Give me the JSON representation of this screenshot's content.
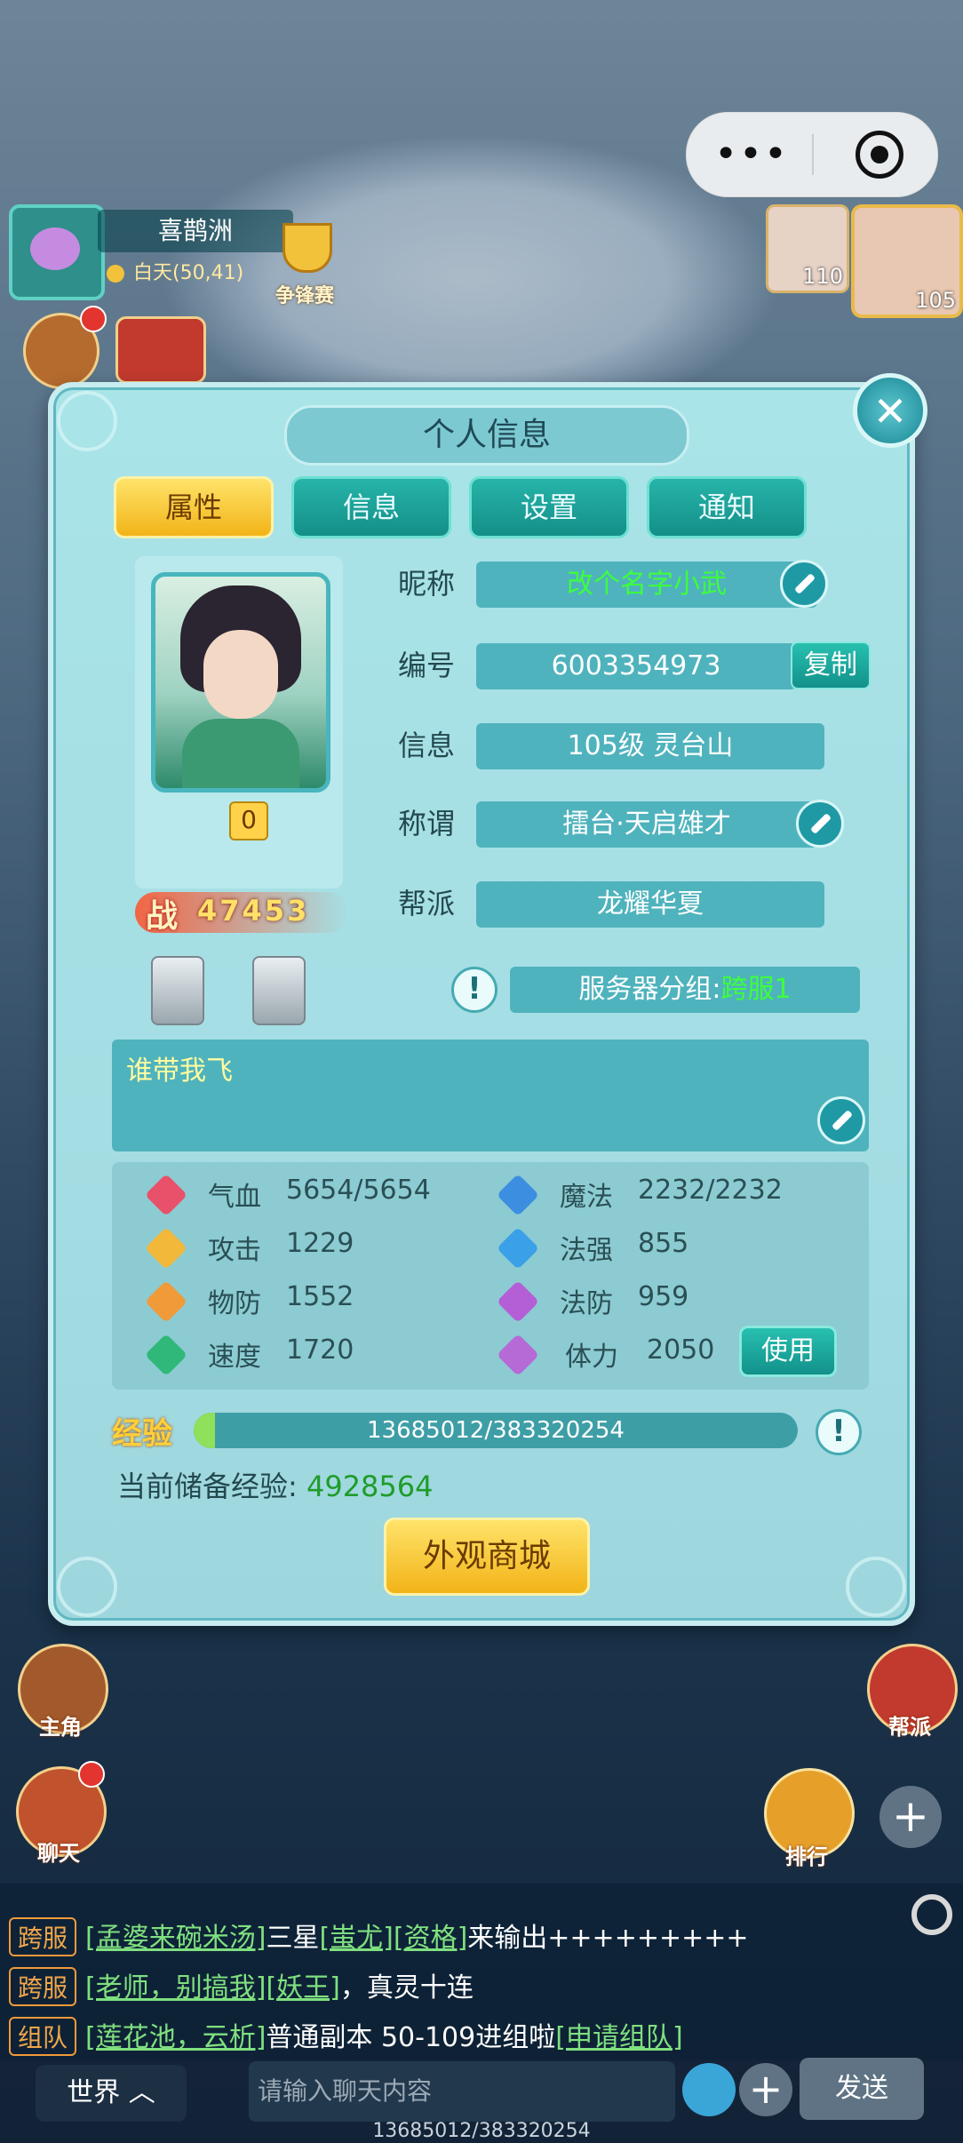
{
  "hud": {
    "location_name": "喜鹊洲",
    "location_time": "白天(50,41)",
    "event_label": "争锋赛",
    "team_levels": [
      "110",
      "105"
    ]
  },
  "modal": {
    "title": "个人信息",
    "tabs": [
      "属性",
      "信息",
      "设置",
      "通知"
    ],
    "active_tab": "属性",
    "nickname_label": "昵称",
    "nickname_value": "改个名字小武",
    "id_label": "编号",
    "id_value": "6003354973",
    "copy_label": "复制",
    "info_label": "信息",
    "info_value": "105级  灵台山",
    "title_label": "称谓",
    "title_value": "擂台·天启雄才",
    "guild_label": "帮派",
    "guild_value": "龙耀华夏",
    "server_prefix": "服务器分组:",
    "server_value": "跨服1",
    "badge_count": "0",
    "power_prefix": "战",
    "power_value": "47453",
    "signature": "谁带我飞",
    "stats": [
      {
        "name": "气血",
        "value": "5654/5654",
        "icon": "heart-icon",
        "color": "#e9506a"
      },
      {
        "name": "魔法",
        "value": "2232/2232",
        "icon": "book-icon",
        "color": "#3c8fe0"
      },
      {
        "name": "攻击",
        "value": "1229",
        "icon": "sword-icon",
        "color": "#f2b83a"
      },
      {
        "name": "法强",
        "value": "855",
        "icon": "magic-icon",
        "color": "#3aa0e8"
      },
      {
        "name": "物防",
        "value": "1552",
        "icon": "shield-icon",
        "color": "#f09a3a"
      },
      {
        "name": "法防",
        "value": "959",
        "icon": "arch-icon",
        "color": "#b55fd6"
      },
      {
        "name": "速度",
        "value": "1720",
        "icon": "lightning-icon",
        "color": "#2fb87a"
      },
      {
        "name": "体力",
        "value": "2050",
        "icon": "drop-icon",
        "color": "#b56ad6"
      }
    ],
    "use_label": "使用",
    "exp_label": "经验",
    "exp_text": "13685012/383320254",
    "exp_fraction": 0.0357,
    "reserve_label": "当前储备经验:",
    "reserve_value": "4928564",
    "shop_label": "外观商城"
  },
  "bottom": {
    "hero_label": "主角",
    "chat_label": "聊天",
    "rank_label": "排行",
    "guild_label": "帮派",
    "chat_lines": [
      {
        "tag": "跨服",
        "parts": [
          {
            "t": "[孟婆来碗米汤]",
            "link": true
          },
          {
            "t": "三星",
            "link": false
          },
          {
            "t": "[蚩尤]",
            "link": true
          },
          {
            "t": "[资格]",
            "link": true
          },
          {
            "t": "来输出+++++++++",
            "link": false
          }
        ]
      },
      {
        "tag": "跨服",
        "parts": [
          {
            "t": "[老师，别搞我]",
            "link": true
          },
          {
            "t": "[妖王]",
            "link": true
          },
          {
            "t": "，真灵十连",
            "link": false
          }
        ]
      },
      {
        "tag": "组队",
        "parts": [
          {
            "t": "[莲花池，云析]",
            "link": true
          },
          {
            "t": "普通副本 50-109进组啦",
            "link": false
          },
          {
            "t": "[申请组队]",
            "link": true
          }
        ]
      }
    ],
    "channel": "世界",
    "input_placeholder": "请输入聊天内容",
    "send_label": "发送",
    "exp_text": "13685012/383320254"
  }
}
